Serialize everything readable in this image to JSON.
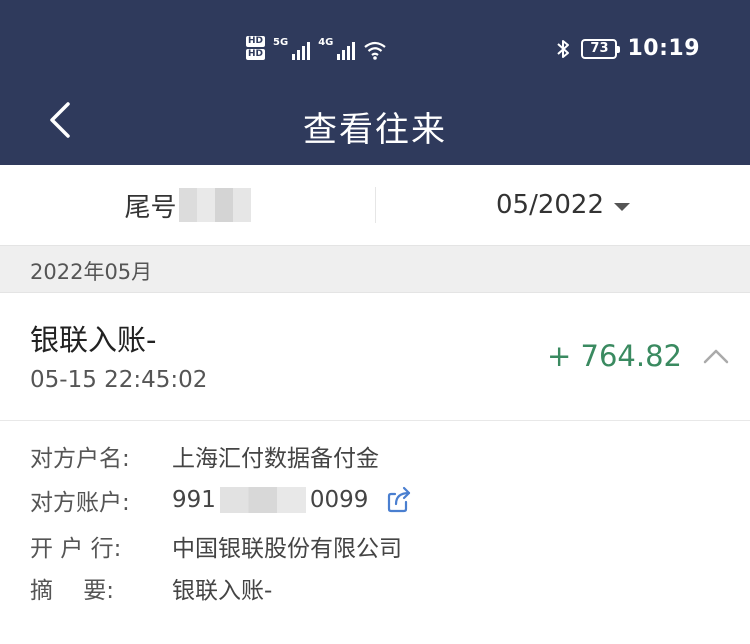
{
  "status_bar": {
    "hd_top": "HD",
    "hd_bottom": "HD",
    "net1": "5G",
    "net2": "4G",
    "battery": "73",
    "time": "10:19",
    "icons": [
      "signal-icon",
      "wifi-icon",
      "bluetooth-icon",
      "battery-icon"
    ]
  },
  "nav": {
    "title": "查看往来",
    "back_icon": "chevron-left-icon"
  },
  "filter": {
    "tail_label": "尾号",
    "date": "05/2022"
  },
  "month_header": "2022年05月",
  "transaction": {
    "title": "银联入账-",
    "time": "05-15 22:45:02",
    "amount": "+ 764.82",
    "amount_color": "#3a8a60",
    "expand_icon": "chevron-up-icon"
  },
  "details": {
    "name_label": "对方户名:",
    "name_value": "上海汇付数据备付金",
    "account_label": "对方账户:",
    "account_prefix": "991",
    "account_suffix": "0099",
    "share_icon": "share-icon",
    "bank_label": "开 户 行:",
    "bank_value": "中国银联股份有限公司",
    "memo_label": "摘　 要:",
    "memo_value": "银联入账-"
  },
  "colors": {
    "header_bg": "#2f3a5c",
    "section_bg": "#efefef",
    "accent_blue": "#4a7fd0"
  }
}
